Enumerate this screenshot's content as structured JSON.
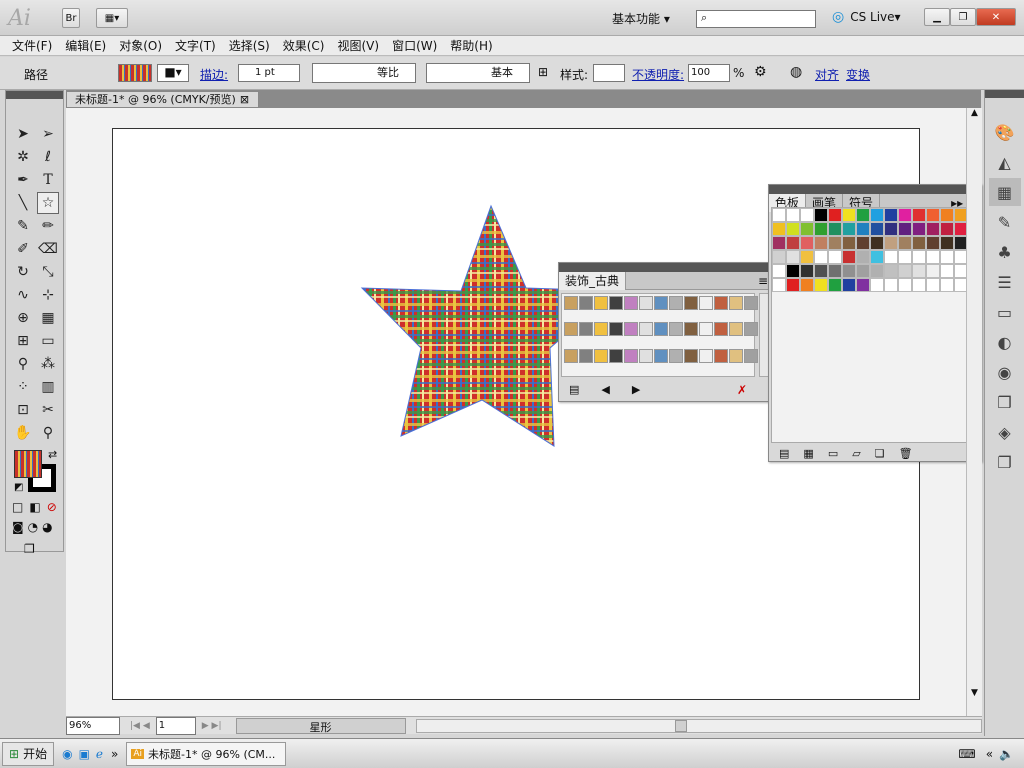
{
  "app": {
    "logo": "Ai",
    "bridge": "Br",
    "workspace": "基本功能",
    "cslive": "CS Live"
  },
  "menu": [
    "文件(F)",
    "编辑(E)",
    "对象(O)",
    "文字(T)",
    "选择(S)",
    "效果(C)",
    "视图(V)",
    "窗口(W)",
    "帮助(H)"
  ],
  "control": {
    "selection_type": "路径",
    "stroke_label": "描边:",
    "stroke_weight": "1 pt",
    "profile_label": "等比",
    "brush_label": "基本",
    "style_label": "样式:",
    "opacity_label": "不透明度:",
    "opacity_value": "100",
    "percent": "%",
    "align": "对齐",
    "transform": "变换"
  },
  "document": {
    "tab_title": "未标题-1* @ 96% (CMYK/预览)"
  },
  "status": {
    "zoom": "96%",
    "artboard_num": "1",
    "info": "星形"
  },
  "pattern_panel": {
    "title": "装饰_古典"
  },
  "swatch_panel": {
    "tabs": [
      "色板",
      "画笔",
      "符号"
    ]
  },
  "taskbar": {
    "start": "开始",
    "task": "未标题-1* @ 96% (CM..."
  },
  "colors": {
    "ui_gray": "#d6d6d6",
    "artboard": "#ffffff",
    "link_blue": "#1020b0",
    "star_path": "#4a6fd8"
  }
}
